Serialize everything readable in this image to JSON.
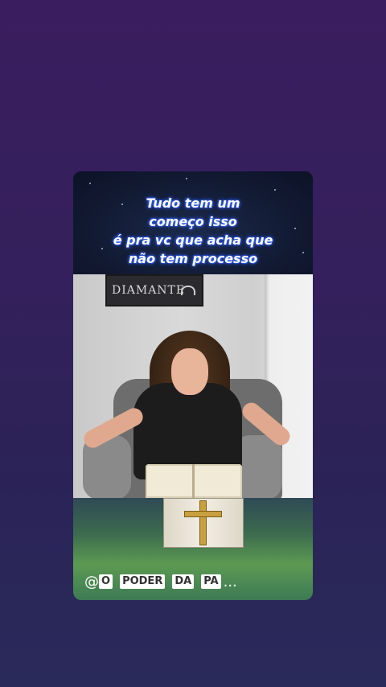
{
  "caption": {
    "line1": "Tudo tem um",
    "line2": "começo isso",
    "line3": "é pra vc que acha que",
    "line4": "não tem processo"
  },
  "sign_text": "DIAMANTE",
  "handle": {
    "at": "@",
    "words": [
      "O",
      "PODER",
      "DA",
      "PA"
    ],
    "ellipsis": "..."
  }
}
